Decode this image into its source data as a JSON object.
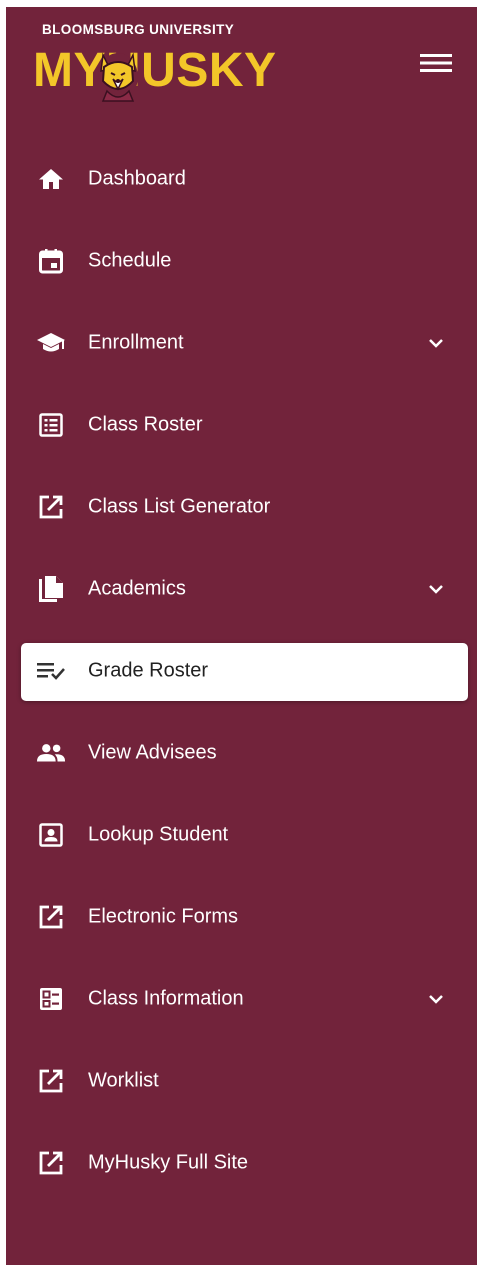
{
  "header": {
    "university": "BLOOMSBURG UNIVERSITY",
    "app_name": "MYHUSKY",
    "menu_icon": "hamburger-menu-icon"
  },
  "colors": {
    "sidebar_bg": "#72233b",
    "brand_gold": "#f3c729",
    "active_bg": "#ffffff",
    "active_text": "#222222"
  },
  "nav": {
    "items": [
      {
        "label": "Dashboard",
        "icon": "home-icon",
        "expandable": false,
        "active": false
      },
      {
        "label": "Schedule",
        "icon": "calendar-icon",
        "expandable": false,
        "active": false
      },
      {
        "label": "Enrollment",
        "icon": "graduation-cap-icon",
        "expandable": true,
        "active": false
      },
      {
        "label": "Class Roster",
        "icon": "list-alt-icon",
        "expandable": false,
        "active": false
      },
      {
        "label": "Class List Generator",
        "icon": "external-link-icon",
        "expandable": false,
        "active": false
      },
      {
        "label": "Academics",
        "icon": "documents-icon",
        "expandable": true,
        "active": false
      },
      {
        "label": "Grade Roster",
        "icon": "list-check-icon",
        "expandable": false,
        "active": true
      },
      {
        "label": "View Advisees",
        "icon": "people-icon",
        "expandable": false,
        "active": false
      },
      {
        "label": "Lookup Student",
        "icon": "person-card-icon",
        "expandable": false,
        "active": false
      },
      {
        "label": "Electronic Forms",
        "icon": "external-link-icon",
        "expandable": false,
        "active": false
      },
      {
        "label": "Class Information",
        "icon": "list-detail-icon",
        "expandable": true,
        "active": false
      },
      {
        "label": "Worklist",
        "icon": "external-link-icon",
        "expandable": false,
        "active": false
      },
      {
        "label": "MyHusky Full Site",
        "icon": "external-link-icon",
        "expandable": false,
        "active": false
      }
    ]
  }
}
